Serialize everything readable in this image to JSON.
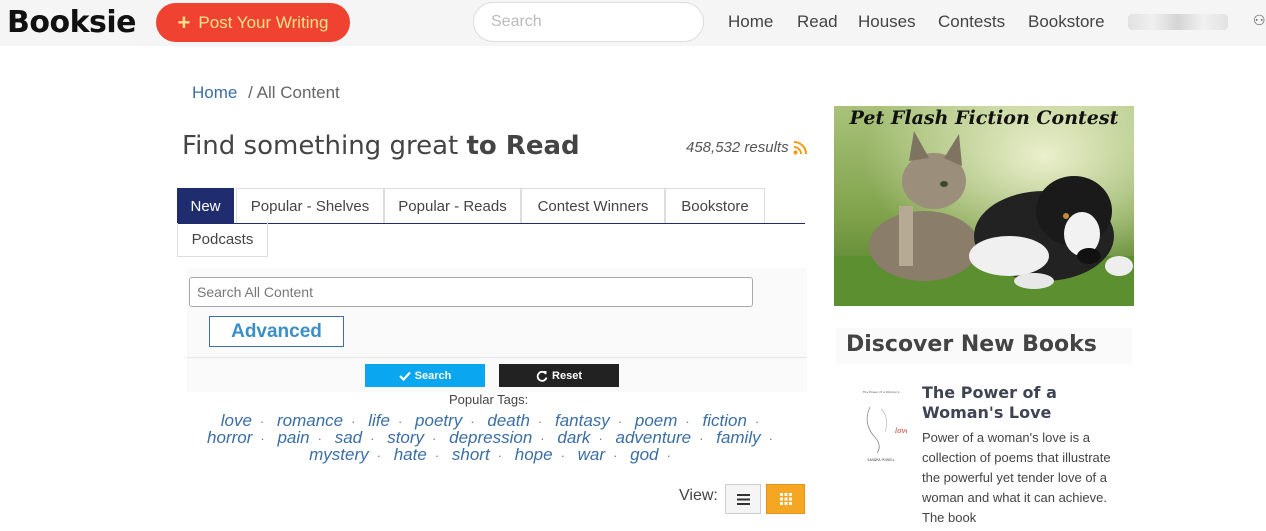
{
  "header": {
    "logo": "Booksie",
    "post_button": "Post Your Writing",
    "search_placeholder": "Search",
    "nav": [
      "Home",
      "Read",
      "Houses",
      "Contests",
      "Bookstore"
    ]
  },
  "breadcrumb": {
    "home": "Home",
    "current": "/ All Content"
  },
  "page": {
    "title_plain": "Find something great ",
    "title_bold": "to Read",
    "results": "458,532 results"
  },
  "tabs": [
    "New",
    "Popular - Shelves",
    "Popular - Reads",
    "Contest Winners",
    "Bookstore",
    "Podcasts"
  ],
  "search_panel": {
    "placeholder": "Search All Content",
    "advanced": "Advanced",
    "search_button": "Search",
    "reset_button": "Reset"
  },
  "tags": {
    "label": "Popular Tags:",
    "items": [
      "love",
      "romance",
      "life",
      "poetry",
      "death",
      "fantasy",
      "poem",
      "fiction",
      "horror",
      "pain",
      "sad",
      "story",
      "depression",
      "dark",
      "adventure",
      "family",
      "mystery",
      "hate",
      "short",
      "hope",
      "war",
      "god"
    ]
  },
  "view": {
    "label": "View:"
  },
  "sidebar": {
    "contest_title": "Pet Flash Fiction Contest",
    "discover_title": "Discover New Books",
    "book": {
      "title": "The Power of a Woman's Love",
      "description": "Power of a woman's love is a collection of poems that illustrate the powerful yet tender love of a woman and what it can achieve. The book",
      "cover_title": "The Power of a Woman's",
      "cover_word": "love",
      "cover_author": "SANDRA POWELL"
    }
  },
  "colors": {
    "post_button": "#f04231",
    "tab_active": "#1f2d6e",
    "search_button": "#0ba6f0",
    "grid_view": "#f5a623",
    "link": "#3b6ea5"
  }
}
